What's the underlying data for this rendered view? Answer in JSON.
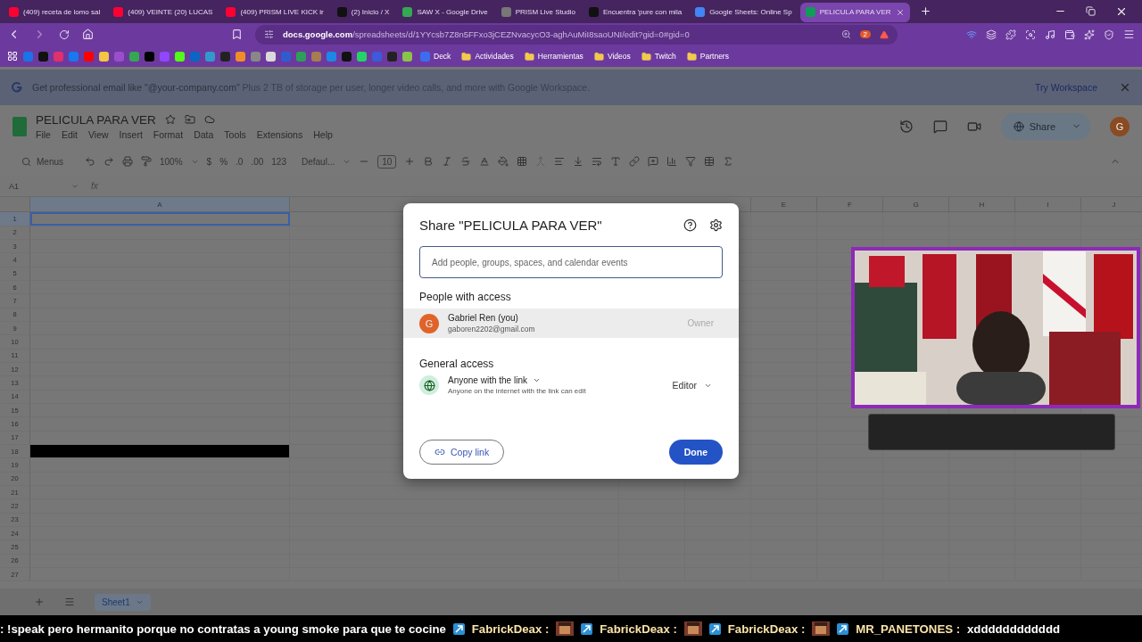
{
  "browser": {
    "tabs": [
      {
        "title": "(409) receta de lomo sal",
        "kind": "youtube",
        "selected": false
      },
      {
        "title": "(409) VEINTE (20) LUCAS",
        "kind": "youtube",
        "selected": false
      },
      {
        "title": "(409) PRISM LIVE KICK ir",
        "kind": "youtube",
        "selected": false
      },
      {
        "title": "(2) Inicio / X",
        "kind": "x",
        "selected": false
      },
      {
        "title": "SAW X - Google Drive",
        "kind": "drive",
        "selected": false
      },
      {
        "title": "PRISM Live Studio",
        "kind": "globe",
        "selected": false
      },
      {
        "title": "Encuentra 'pure con mila",
        "kind": "tiktok",
        "selected": false
      },
      {
        "title": "Google Sheets: Online Sp",
        "kind": "google",
        "selected": false
      },
      {
        "title": "PELICULA PARA VER",
        "kind": "sheets",
        "selected": true
      }
    ],
    "url_host": "docs.google.com",
    "url_path": "/spreadsheets/d/1YYcsb7Z8n5FFxo3jCEZNvacycO3-aghAuMiI8saoUNI/edit?gid=0#gid=0",
    "shield_count": "2",
    "bookmarks": [
      {
        "label": "Deck",
        "kind": "site"
      },
      {
        "label": "Actividades",
        "kind": "folder"
      },
      {
        "label": "Herramientas",
        "kind": "folder"
      },
      {
        "label": "Videos",
        "kind": "folder"
      },
      {
        "label": "Twitch",
        "kind": "folder"
      },
      {
        "label": "Partners",
        "kind": "folder"
      }
    ]
  },
  "banner": {
    "lead": "Get professional email like \"@your-company.com\"",
    "text": "Plus 2 TB of storage per user, longer video calls, and more with Google Workspace.",
    "action": "Try Workspace"
  },
  "sheet": {
    "title": "PELICULA PARA VER",
    "menu": [
      "File",
      "Edit",
      "View",
      "Insert",
      "Format",
      "Data",
      "Tools",
      "Extensions",
      "Help"
    ],
    "share": "Share",
    "avatar": "G",
    "toolbar": {
      "search": "Menus",
      "zoom": "100%",
      "currency": "$",
      "percent": "%",
      "decrease_decimal": ".0",
      "increase_decimal": ".00",
      "number_format": "123",
      "font": "Defaul...",
      "font_size": "10"
    },
    "name_box": "A1",
    "formula_label": "fx",
    "columns": [
      {
        "label": "A",
        "selected": true
      },
      {
        "label": "E",
        "selected": false
      },
      {
        "label": "F",
        "selected": false
      },
      {
        "label": "G",
        "selected": false
      },
      {
        "label": "H",
        "selected": false
      },
      {
        "label": "I",
        "selected": false
      },
      {
        "label": "J",
        "selected": false
      }
    ],
    "rows": [
      {
        "label": "1",
        "selected": true,
        "filled": false
      },
      {
        "label": "2",
        "selected": false,
        "filled": false
      },
      {
        "label": "3",
        "selected": false,
        "filled": false
      },
      {
        "label": "4",
        "selected": false,
        "filled": false
      },
      {
        "label": "5",
        "selected": false,
        "filled": false
      },
      {
        "label": "6",
        "selected": false,
        "filled": false
      },
      {
        "label": "7",
        "selected": false,
        "filled": false
      },
      {
        "label": "8",
        "selected": false,
        "filled": false
      },
      {
        "label": "9",
        "selected": false,
        "filled": false
      },
      {
        "label": "10",
        "selected": false,
        "filled": false
      },
      {
        "label": "11",
        "selected": false,
        "filled": false
      },
      {
        "label": "12",
        "selected": false,
        "filled": false
      },
      {
        "label": "13",
        "selected": false,
        "filled": false
      },
      {
        "label": "14",
        "selected": false,
        "filled": false
      },
      {
        "label": "15",
        "selected": false,
        "filled": false
      },
      {
        "label": "16",
        "selected": false,
        "filled": false
      },
      {
        "label": "17",
        "selected": false,
        "filled": false
      },
      {
        "label": "18",
        "selected": false,
        "filled": true
      },
      {
        "label": "19",
        "selected": false,
        "filled": false
      },
      {
        "label": "20",
        "selected": false,
        "filled": false
      },
      {
        "label": "21",
        "selected": false,
        "filled": false
      },
      {
        "label": "22",
        "selected": false,
        "filled": false
      },
      {
        "label": "23",
        "selected": false,
        "filled": false
      },
      {
        "label": "24",
        "selected": false,
        "filled": false
      },
      {
        "label": "25",
        "selected": false,
        "filled": false
      },
      {
        "label": "26",
        "selected": false,
        "filled": false
      },
      {
        "label": "27",
        "selected": false,
        "filled": false
      }
    ],
    "sheet_tabs": [
      {
        "label": "Sheet1",
        "selected": true
      }
    ]
  },
  "dialog": {
    "title": "Share \"PELICULA PARA VER\"",
    "placeholder": "Add people, groups, spaces, and calendar events",
    "people_heading": "People with access",
    "people": [
      {
        "avatar": "G",
        "name": "Gabriel Ren (you)",
        "email": "gaboren2202@gmail.com",
        "role": "Owner"
      }
    ],
    "general_heading": "General access",
    "access": "Anyone with the link",
    "access_note": "Anyone on the internet with the link can edit",
    "role": "Editor",
    "copy_link": "Copy link",
    "done": "Done"
  },
  "chat_ticker": [
    {
      "kind": "text",
      "text": ": !speak pero hermanito porque no contratas a young smoke para que te cocine"
    },
    {
      "kind": "emote",
      "user": "FabrickDeax :"
    },
    {
      "kind": "emote",
      "user": "FabrickDeax :"
    },
    {
      "kind": "emote",
      "user": "FabrickDeax :"
    },
    {
      "kind": "message",
      "user": "MR_PANETONES :",
      "text": "xdddddddddddd"
    }
  ]
}
